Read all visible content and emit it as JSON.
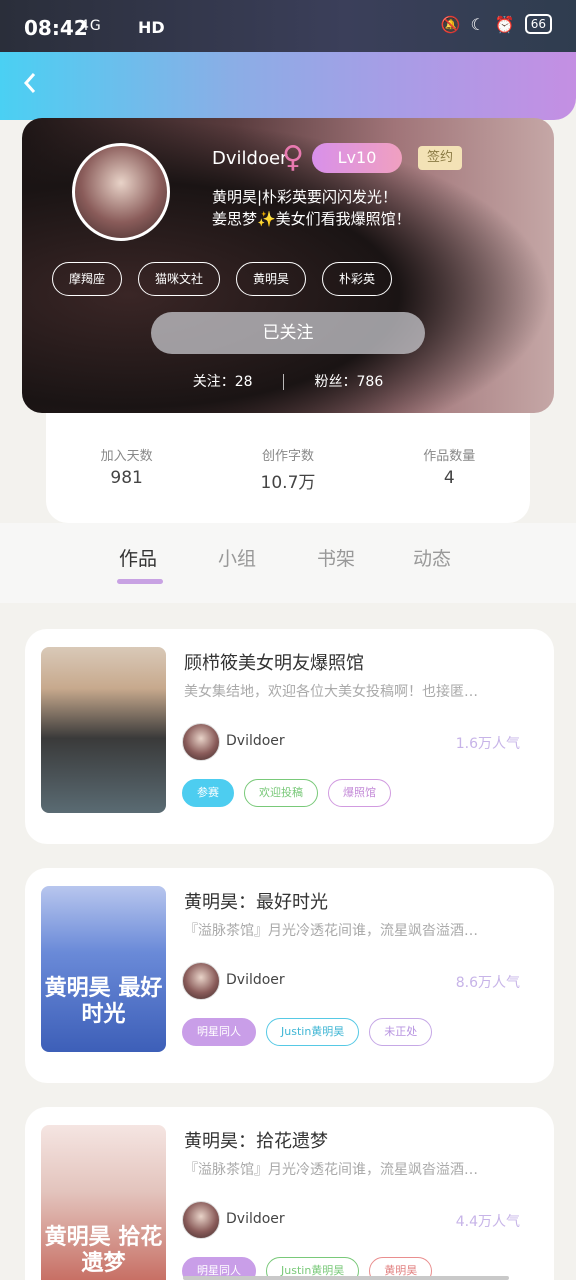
{
  "status": {
    "time": "08:42",
    "network": "4G",
    "hd": "HD",
    "battery": "66"
  },
  "profile": {
    "username": "Dvildoer",
    "gender_symbol": "♀",
    "level": "Lv10",
    "badge": "签约",
    "bio_line1": "黄明昊|朴彩英要闪闪发光！",
    "bio_line2": "姜思梦✨美女们看我爆照馆！",
    "tags": [
      "摩羯座",
      "猫咪文社",
      "黄明昊",
      "朴彩英"
    ],
    "follow_button": "已关注",
    "following_label": "关注：28",
    "fans_label": "粉丝：786"
  },
  "stats": [
    {
      "label": "加入天数",
      "value": "981"
    },
    {
      "label": "创作字数",
      "value": "10.7万"
    },
    {
      "label": "作品数量",
      "value": "4"
    }
  ],
  "tabs": [
    "作品",
    "小组",
    "书架",
    "动态"
  ],
  "works": [
    {
      "title": "顾栉筱美女明友爆照馆",
      "desc": "美女集结地，欢迎各位大美女投稿啊！也接匿…",
      "author": "Dvildoer",
      "popularity": "1.6万人气",
      "tags": [
        "参赛",
        "欢迎投稿",
        "爆照馆"
      ],
      "cover_text": ""
    },
    {
      "title": "黄明昊：最好时光",
      "desc": "『溢脉茶馆』月光冷透花间谁，流星飒沓溢酒…",
      "author": "Dvildoer",
      "popularity": "8.6万人气",
      "tags": [
        "明星同人",
        "Justin黄明昊",
        "未正处"
      ],
      "cover_text": "黄明昊 最好时光"
    },
    {
      "title": "黄明昊：拾花遗梦",
      "desc": "『溢脉茶馆』月光冷透花间谁，流星飒沓溢酒…",
      "author": "Dvildoer",
      "popularity": "4.4万人气",
      "tags": [
        "明星同人",
        "Justin黄明昊",
        "黄明昊"
      ],
      "cover_text": "黄明昊 拾花遗梦"
    }
  ]
}
